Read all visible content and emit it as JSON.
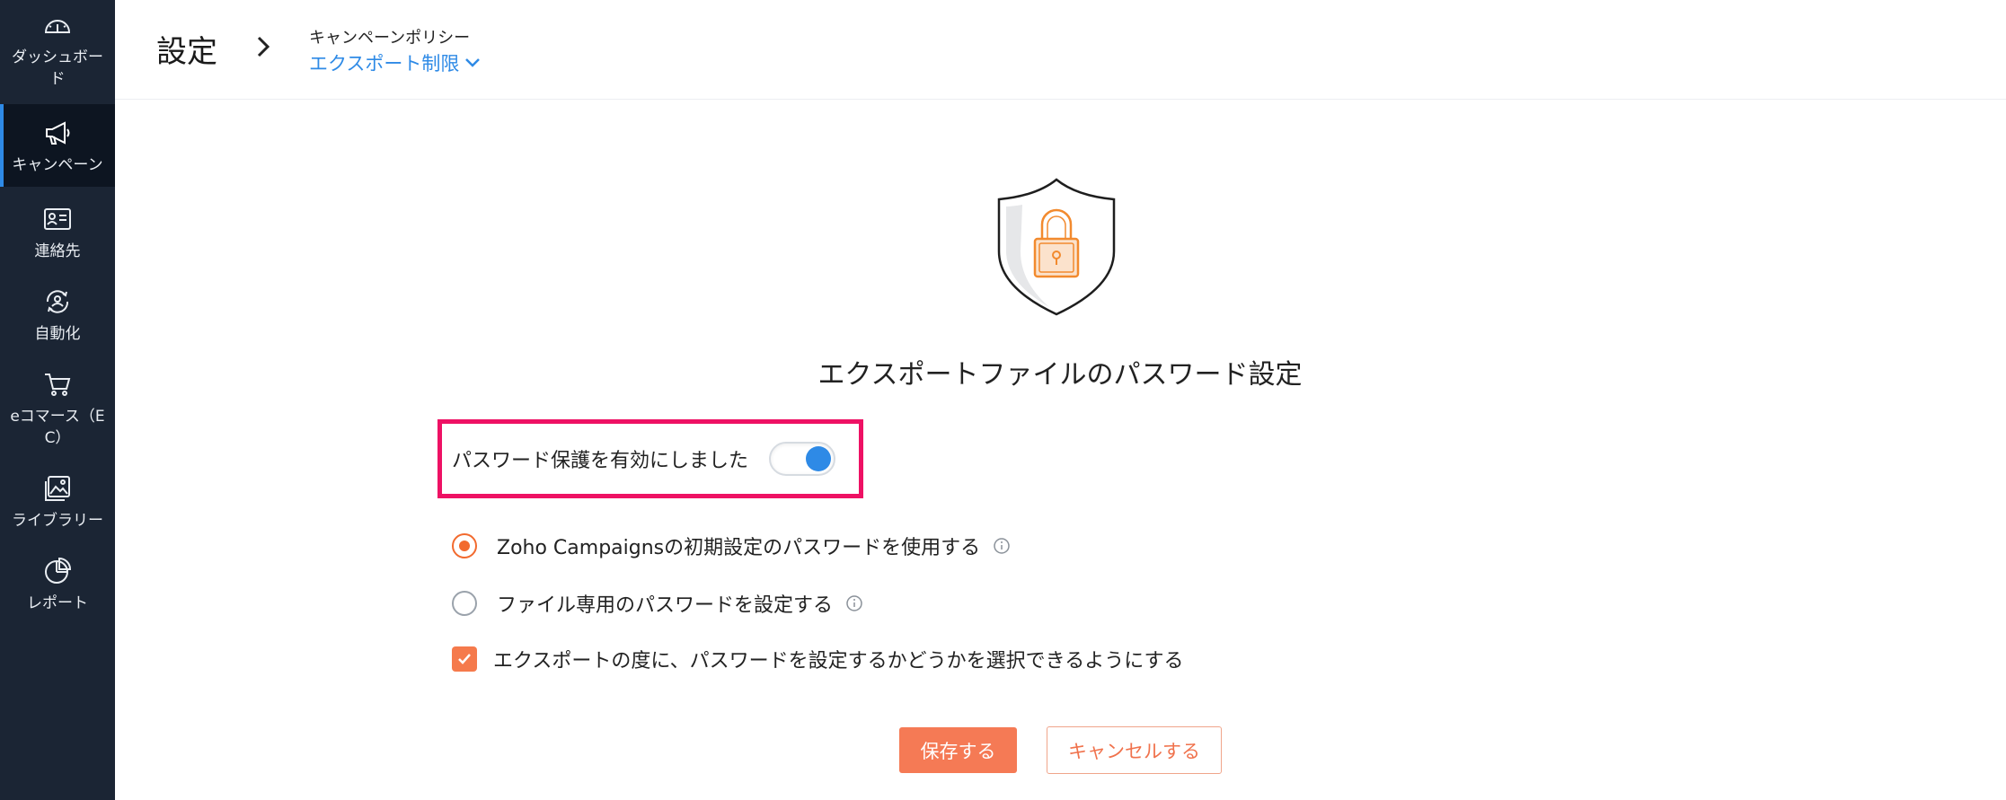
{
  "sidebar": {
    "items": [
      {
        "label": "ダッシュボード",
        "icon": "gauge-icon"
      },
      {
        "label": "キャンペーン",
        "icon": "megaphone-icon",
        "active": true
      },
      {
        "label": "連絡先",
        "icon": "contact-card-icon"
      },
      {
        "label": "自動化",
        "icon": "automation-icon"
      },
      {
        "label": "eコマース（EC）",
        "icon": "cart-icon"
      },
      {
        "label": "ライブラリー",
        "icon": "image-library-icon"
      },
      {
        "label": "レポート",
        "icon": "pie-chart-icon"
      }
    ]
  },
  "header": {
    "title": "設定",
    "breadcrumb_parent": "キャンペーンポリシー",
    "breadcrumb_current": "エクスポート制限"
  },
  "main": {
    "section_title": "エクスポートファイルのパスワード設定",
    "toggle": {
      "label": "パスワード保護を有効にしました",
      "enabled": true
    },
    "options": [
      {
        "label": "Zoho Campaignsの初期設定のパスワードを使用する",
        "checked": true
      },
      {
        "label": "ファイル専用のパスワードを設定する",
        "checked": false
      }
    ],
    "checkbox": {
      "label": "エクスポートの度に、パスワードを設定するかどうかを選択できるようにする",
      "checked": true
    },
    "save_label": "保存する",
    "cancel_label": "キャンセルする"
  },
  "colors": {
    "sidebar_bg": "#1b2534",
    "accent_blue": "#2e8ae6",
    "accent_orange": "#f57a55",
    "highlight": "#ee1164"
  }
}
